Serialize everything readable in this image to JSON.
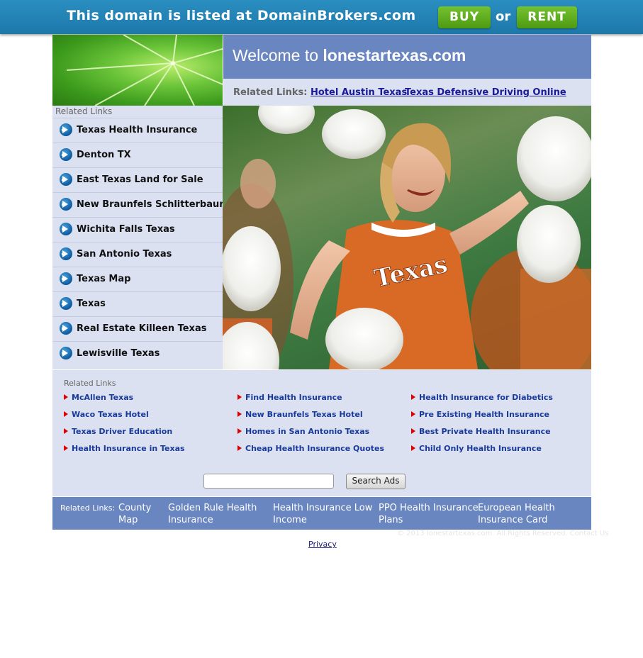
{
  "banner": {
    "text": "This domain is listed at DomainBrokers.com",
    "buy_label": "BUY",
    "or_label": "or",
    "rent_label": "RENT"
  },
  "welcome": {
    "prefix": "Welcome to ",
    "domain": "lonestartexas.com"
  },
  "top_links": {
    "label": "Related Links:",
    "items": [
      "Hotel Austin Texas",
      "Texas Defensive Driving Online"
    ]
  },
  "sidebar": {
    "heading": "Related Links",
    "items": [
      "Texas Health Insurance",
      "Denton TX",
      "East Texas Land for Sale",
      "New Braunfels Schlitterbaun",
      "Wichita Falls Texas",
      "San Antonio Texas",
      "Texas Map",
      "Texas",
      "Real Estate Killeen Texas",
      "Lewisville Texas"
    ]
  },
  "photo": {
    "shirt_text": "Texas"
  },
  "related": {
    "heading": "Related Links",
    "columns": [
      [
        "McAllen Texas",
        "Waco Texas Hotel",
        "Texas Driver Education",
        "Health Insurance in Texas"
      ],
      [
        "Find Health Insurance",
        "New Braunfels Texas Hotel",
        "Homes in San Antonio Texas",
        "Cheap Health Insurance Quotes"
      ],
      [
        "Health Insurance for Diabetics",
        "Pre Existing Health Insurance",
        "Best Private Health Insurance",
        "Child Only Health Insurance"
      ]
    ]
  },
  "search": {
    "value": "",
    "button_label": "Search Ads"
  },
  "footer": {
    "label": "Related Links:",
    "links": [
      [
        "County",
        "Map"
      ],
      [
        "Golden Rule Health",
        "Insurance"
      ],
      [
        "Health Insurance Low",
        "Income"
      ],
      [
        "PPO Health Insurance",
        "Plans"
      ],
      [
        "European Health",
        "Insurance Card"
      ]
    ],
    "copyright": "© 2013 lonestartexas.com. All Rights Reserved. Contact Us",
    "privacy": "Privacy"
  },
  "colors": {
    "banner": "#1e78aa",
    "button_green": "#5aaa1a",
    "header_blue": "#6a86c1",
    "panel": "#dbe1f0",
    "link_blue": "#1a3a9a"
  }
}
